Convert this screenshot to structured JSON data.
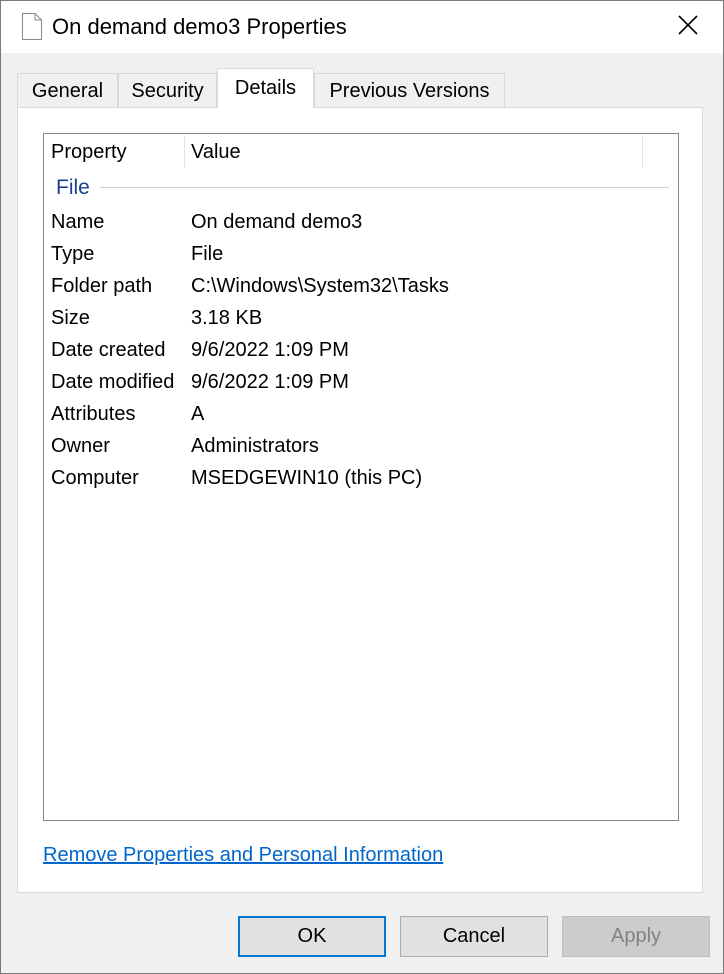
{
  "window": {
    "title": "On demand demo3 Properties"
  },
  "tabs": [
    {
      "label": "General"
    },
    {
      "label": "Security"
    },
    {
      "label": "Details"
    },
    {
      "label": "Previous Versions"
    }
  ],
  "details": {
    "column_property": "Property",
    "column_value": "Value",
    "group_label": "File",
    "rows": [
      {
        "name": "Name",
        "value": "On demand demo3"
      },
      {
        "name": "Type",
        "value": "File"
      },
      {
        "name": "Folder path",
        "value": "C:\\Windows\\System32\\Tasks"
      },
      {
        "name": "Size",
        "value": "3.18 KB"
      },
      {
        "name": "Date created",
        "value": "9/6/2022 1:09 PM"
      },
      {
        "name": "Date modified",
        "value": "9/6/2022 1:09 PM"
      },
      {
        "name": "Attributes",
        "value": "A"
      },
      {
        "name": "Owner",
        "value": "Administrators"
      },
      {
        "name": "Computer",
        "value": "MSEDGEWIN10 (this PC)"
      }
    ]
  },
  "remove_link": "Remove Properties and Personal Information",
  "buttons": {
    "ok": "OK",
    "cancel": "Cancel",
    "apply": "Apply"
  },
  "icons": {
    "title_icon": "document-icon",
    "close_icon": "close-icon"
  }
}
